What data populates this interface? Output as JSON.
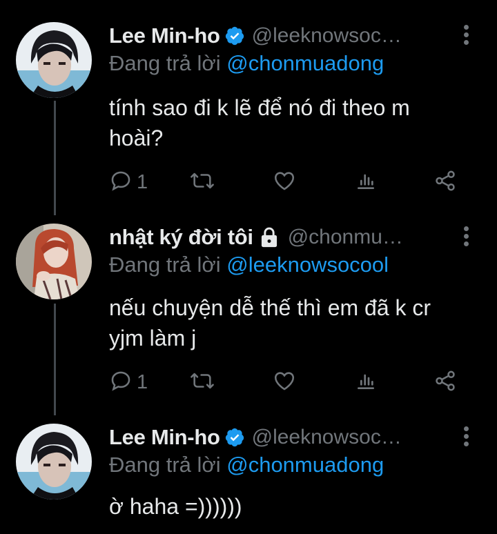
{
  "colors": {
    "background": "#000000",
    "primary_text": "#e7e9ea",
    "secondary_text": "#71767b",
    "link": "#1d9bf0",
    "verified": "#1d9bf0",
    "thread_line": "#42484e"
  },
  "tweets": [
    {
      "display_name": "Lee Min-ho",
      "handle": "@leeknowsoc…",
      "verified": true,
      "protected": false,
      "reply_prefix": "Đang trả lời ",
      "reply_to": "@chonmuadong",
      "text": "tính sao đi k lẽ để nó đi theo m hoài?",
      "reply_count": "1",
      "retweet_count": "",
      "like_count": "",
      "icons": [
        "reply-icon",
        "retweet-icon",
        "like-icon",
        "views-icon",
        "share-icon"
      ]
    },
    {
      "display_name": "nhật ký đời tôi",
      "handle": "@chonmu…",
      "verified": false,
      "protected": true,
      "reply_prefix": "Đang trả lời ",
      "reply_to": "@leeknowsocool",
      "text": "nếu chuyện dễ thế thì em đã k cr yjm làm j",
      "reply_count": "1",
      "retweet_count": "",
      "like_count": "",
      "icons": [
        "reply-icon",
        "retweet-icon",
        "like-icon",
        "views-icon",
        "share-icon"
      ]
    },
    {
      "display_name": "Lee Min-ho",
      "handle": "@leeknowsoc…",
      "verified": true,
      "protected": false,
      "reply_prefix": "Đang trả lời ",
      "reply_to": "@chonmuadong",
      "text": "ờ haha =))))))"
    }
  ]
}
